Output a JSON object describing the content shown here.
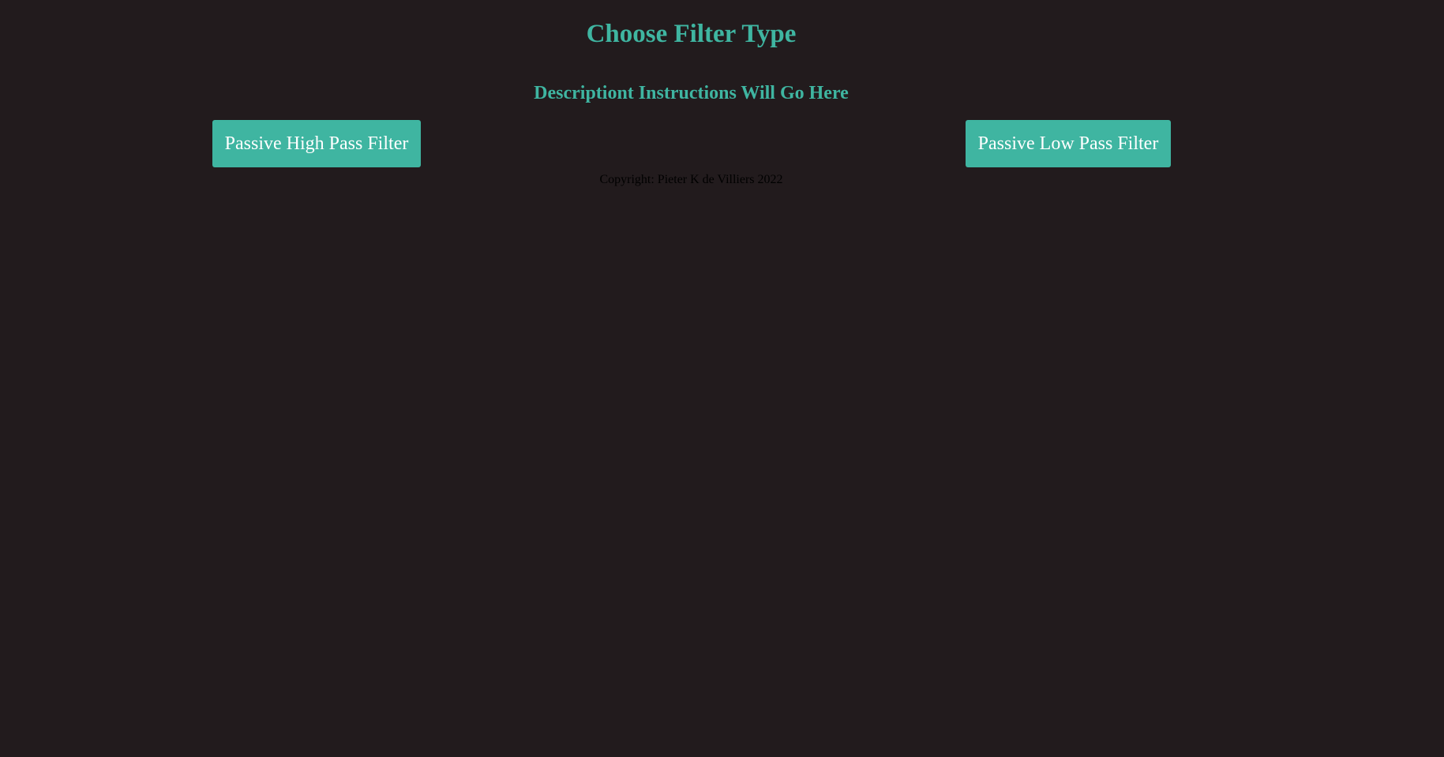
{
  "header": {
    "title": "Choose Filter Type",
    "subtitle": "Descriptiont Instructions Will Go Here"
  },
  "buttons": {
    "high_pass_label": "Passive High Pass Filter",
    "low_pass_label": "Passive Low Pass Filter"
  },
  "footer": {
    "copyright": "Copyright: Pieter K de Villiers 2022"
  },
  "colors": {
    "background": "#221b1d",
    "accent": "#3fb5a1",
    "button_text": "#ffffff",
    "footer_text": "#000000"
  }
}
